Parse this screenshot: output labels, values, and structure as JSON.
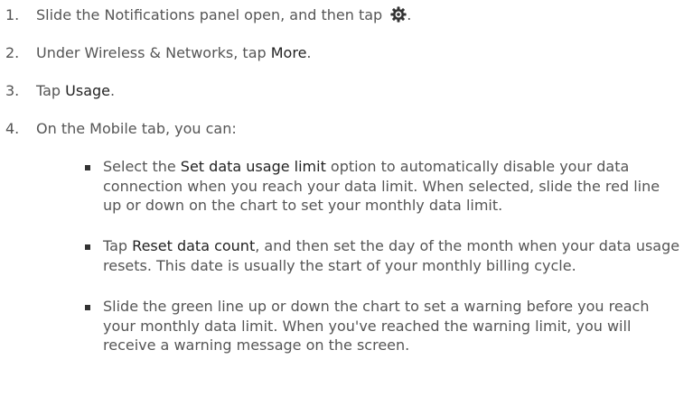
{
  "steps": [
    {
      "number": "1.",
      "before": "Slide the Notifications panel open, and then tap ",
      "icon": "gear-icon",
      "after": "."
    },
    {
      "number": "2.",
      "before": "Under Wireless & Networks, tap ",
      "emphasis": "More",
      "after": "."
    },
    {
      "number": "3.",
      "before": "Tap ",
      "emphasis": "Usage",
      "after": "."
    },
    {
      "number": "4.",
      "text": "On the Mobile tab, you can:"
    }
  ],
  "bullets": [
    {
      "before": "Select the ",
      "emphasis": "Set data usage limit",
      "after": " option to automatically disable your data connection when you reach your data limit. When selected, slide the red line up or down on the chart to set your monthly data limit."
    },
    {
      "before": "Tap ",
      "emphasis": "Reset data count",
      "after": ", and then set the day of the month when your data usage resets. This date is usually the start of your monthly billing cycle."
    },
    {
      "before": "",
      "emphasis": "",
      "after": "Slide the green line up or down the chart to set a warning before you reach your monthly data limit. When you've reached the warning limit, you will receive a warning message on the screen."
    }
  ]
}
